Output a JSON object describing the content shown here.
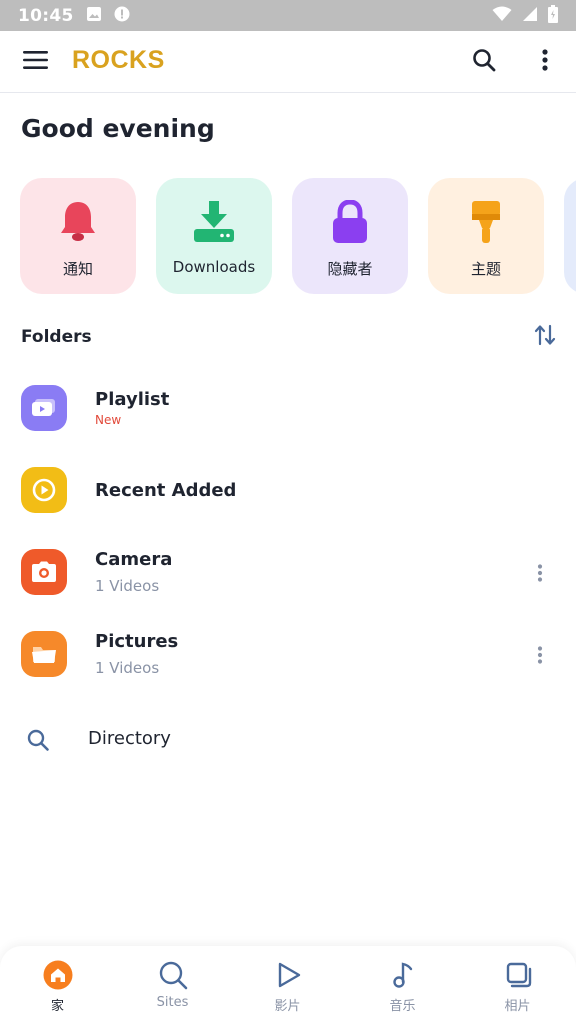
{
  "status_bar": {
    "time": "10:45"
  },
  "app_bar": {
    "logo": "ROCKS"
  },
  "greeting": "Good evening",
  "tiles": [
    {
      "label": "通知",
      "icon": "bell-icon",
      "color": "#e8455b"
    },
    {
      "label": "Downloads",
      "icon": "download-icon",
      "color": "#22b573"
    },
    {
      "label": "隐藏者",
      "icon": "lock-icon",
      "color": "#8b3ff0"
    },
    {
      "label": "主题",
      "icon": "paint-brush-icon",
      "color": "#f5a31a"
    }
  ],
  "folders_section": {
    "title": "Folders"
  },
  "folders": [
    {
      "name": "Playlist",
      "badge": "New",
      "icon": "playlist-icon",
      "color": "#8a7cf4"
    },
    {
      "name": "Recent Added",
      "icon": "recent-play-icon",
      "color": "#f2bd16"
    },
    {
      "name": "Camera",
      "subtitle": "1 Videos",
      "icon": "camera-icon",
      "color": "#ef5a2a"
    },
    {
      "name": "Pictures",
      "subtitle": "1 Videos",
      "icon": "folder-icon",
      "color": "#f6892a"
    }
  ],
  "directory": {
    "label": "Directory"
  },
  "bottom_nav": [
    {
      "label": "家",
      "icon": "home-icon",
      "active": true
    },
    {
      "label": "Sites",
      "icon": "search-icon"
    },
    {
      "label": "影片",
      "icon": "play-icon"
    },
    {
      "label": "音乐",
      "icon": "music-note-icon"
    },
    {
      "label": "相片",
      "icon": "photos-icon"
    }
  ],
  "colors": {
    "accent": "#f77e1e",
    "muted": "#8a93a6",
    "text": "#1f2430"
  }
}
